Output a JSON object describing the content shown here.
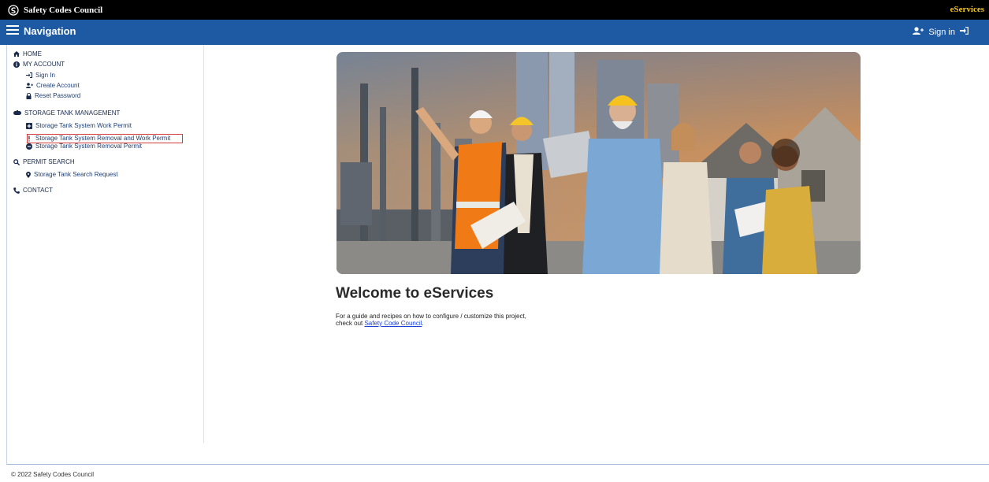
{
  "header": {
    "brand": "Safety Codes Council",
    "right_label": "eServices"
  },
  "navbar": {
    "menu_label": "Navigation",
    "signin_label": "Sign in"
  },
  "sidebar": {
    "home": "HOME",
    "my_account": "MY ACCOUNT",
    "sign_in": "Sign In",
    "create_account": "Create Account",
    "reset_password": "Reset Password",
    "storage_tank": "STORAGE TANK MANAGEMENT",
    "work_permit": "Storage Tank System Work Permit",
    "removal_work_permit": "Storage Tank System Removal and Work Permit",
    "removal_permit": "Storage Tank System Removal Permit",
    "permit_search": "PERMIT SEARCH",
    "search_request": "Storage Tank Search Request",
    "contact": "CONTACT"
  },
  "main": {
    "welcome_title": "Welcome to eServices",
    "desc_line1": "For a guide and recipes on how to configure / customize this project,",
    "desc_prefix": "check out ",
    "desc_link": "Safety Code Council",
    "desc_suffix": "."
  },
  "footer": {
    "copyright": "© 2022 Safety Codes Council"
  },
  "colors": {
    "topbar": "#000000",
    "navbar": "#1d5aa3",
    "sidebar_link": "#1f3f73",
    "highlight": "#d43b3b",
    "link": "#1a3fd1"
  },
  "icons": {
    "brand": "council-logo-icon",
    "menu": "hamburger-icon",
    "signin": "user-plus-icon",
    "home": "home-icon",
    "account": "info-circle-icon",
    "signin_link": "sign-in-icon",
    "create": "user-plus-icon",
    "reset": "lock-icon",
    "tank": "tank-icon",
    "work_permit": "plus-square-icon",
    "removal_work": "exclamation-icon",
    "removal": "minus-circle-icon",
    "search": "search-icon",
    "search_request": "map-marker-icon",
    "contact": "phone-icon"
  }
}
